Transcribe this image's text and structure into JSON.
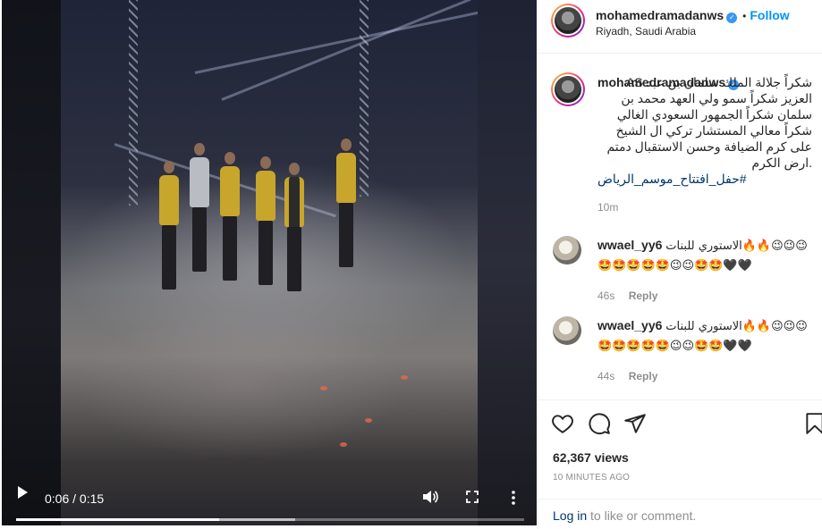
{
  "header": {
    "username": "mohamedramadanws",
    "verified_icon": "verified-badge-icon",
    "separator": "•",
    "follow_label": "Follow",
    "location": "Riyadh, Saudi Arabia"
  },
  "caption": {
    "username": "mohamedramadanws",
    "text": "AS شكراً جلالة الملك سلمان بن عبد العزيز شكراً سمو ولي العهد محمد بن سلمان شكراً الجمهور السعودي الغالي شكراً معالي المستشار تركي ال الشيخ على كرم الضيافة وحسن الاستقبال دمتم ارض الكرم.",
    "hashtag": "#حفل_افتتاح_موسم_الرياض",
    "time": "10m"
  },
  "comments": [
    {
      "username": "wwael_yy6",
      "text": "الاستوري للبنات🔥🔥😉😉😉",
      "emojis": "🤩🤩🤩🤩🤩😉😉🤩🤩🖤🖤",
      "time": "46s",
      "reply_label": "Reply"
    },
    {
      "username": "wwael_yy6",
      "text": "الاستوري للبنات🔥🔥😉😉😉",
      "emojis": "🤩🤩🤩🤩🤩😉😉🤩🤩🖤🖤",
      "time": "44s",
      "reply_label": "Reply"
    }
  ],
  "video": {
    "current_time": "0:06",
    "duration": "0:15",
    "time_display": "0:06 / 0:15",
    "played_fraction": 0.4,
    "buffered_fraction": 0.55,
    "icons": [
      "play-icon",
      "volume-icon",
      "fullscreen-icon",
      "more-options-icon"
    ]
  },
  "actions": {
    "icons": [
      "like-heart-icon",
      "comment-bubble-icon",
      "share-paper-plane-icon",
      "save-bookmark-icon"
    ],
    "views": "62,367 views",
    "posted": "10 MINUTES AGO",
    "login_link": "Log in",
    "login_suffix": " to like or comment."
  },
  "colors": {
    "link_blue": "#0095f6",
    "hashtag": "#00376b",
    "muted": "#8e8e8e",
    "verified": "#3897f0"
  }
}
